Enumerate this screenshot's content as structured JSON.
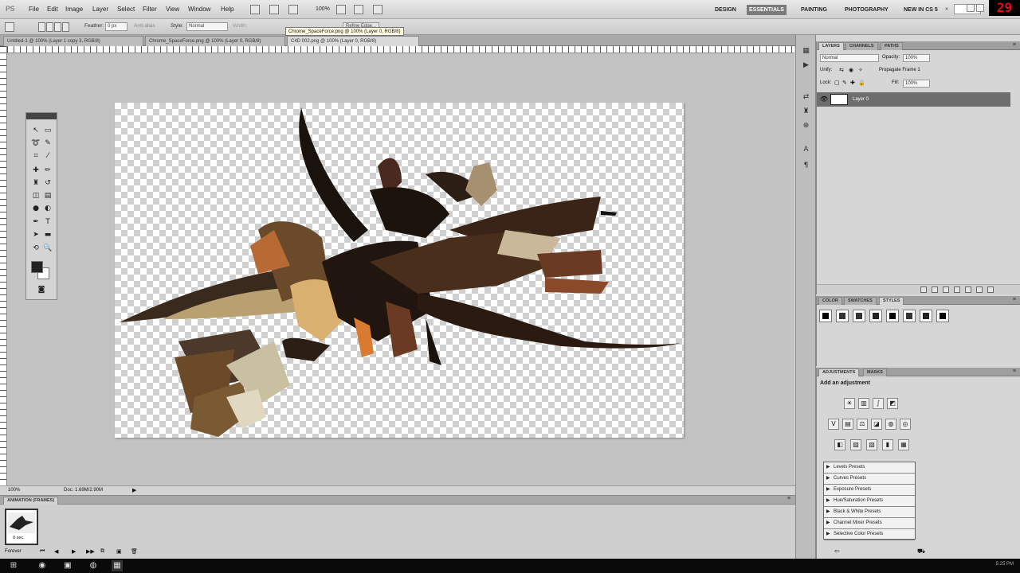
{
  "app": {
    "logo": "PS"
  },
  "menu": [
    "File",
    "Edit",
    "Image",
    "Layer",
    "Select",
    "Filter",
    "View",
    "Window",
    "Help"
  ],
  "toolbar": {
    "zoom": "100%"
  },
  "workspaces": [
    "DESIGN",
    "ESSENTIALS",
    "PAINTING",
    "PHOTOGRAPHY",
    "NEW IN CS 5"
  ],
  "workspace_more": "»",
  "recording_counter": "29",
  "options": {
    "feather_label": "Feather:",
    "feather_value": "0 px",
    "antialias": "Anti-alias",
    "style_label": "Style:",
    "style_value": "Normal",
    "width_label": "Width:",
    "refine": "Refine Edge..."
  },
  "doc_tabs": [
    "Untitled-1 @ 100% (Layer 1 copy 3, RGB/8)",
    "Chrome_SpaceForce.png @ 100% (Layer 0, RGB/8)",
    "C4D 002.png @ 100% (Layer 0, RGB/8)"
  ],
  "tooltip": "Chrome_SpaceForce.png @ 100% (Layer 0, RGB/8)",
  "status": {
    "zoom": "100%",
    "doc": "Doc: 1.69M/2.90M"
  },
  "animation": {
    "tab": "ANIMATION (FRAMES)",
    "frame_time": "0 sec.",
    "loop": "Forever"
  },
  "layers_panel": {
    "tabs": [
      "LAYERS",
      "CHANNELS",
      "PATHS"
    ],
    "blend": "Normal",
    "opacity_label": "Opacity:",
    "opacity": "100%",
    "unify": "Unify:",
    "propagate": "Propagate Frame 1",
    "lock": "Lock:",
    "fill_label": "Fill:",
    "fill": "100%",
    "layer_name": "Layer 0"
  },
  "styles_panel": {
    "tabs": [
      "COLOR",
      "SWATCHES",
      "STYLES"
    ]
  },
  "adjust_panel": {
    "tabs": [
      "ADJUSTMENTS",
      "MASKS"
    ],
    "title": "Add an adjustment",
    "presets": [
      "Levels Presets",
      "Curves Presets",
      "Exposure Presets",
      "Hue/Saturation Presets",
      "Black & White Presets",
      "Channel Mixer Presets",
      "Selective Color Presets"
    ]
  },
  "taskbar": {
    "time": "5:25 PM"
  }
}
